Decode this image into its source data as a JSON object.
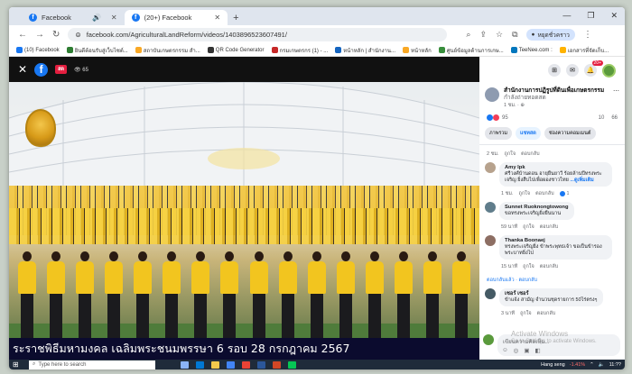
{
  "browser": {
    "tabs": [
      {
        "label": "Facebook",
        "active": false
      },
      {
        "label": "(20+) Facebook",
        "active": true
      }
    ],
    "new_tab": "+",
    "url": "facebook.com/AgriculturalLandReform/videos/1403896523607491/",
    "profile_label": "หยุดชั่วคราว",
    "bookmarks": [
      "(10) Facebook",
      "ยินดีต้อนรับสู่เว็บไซต์...",
      "สถาบันเกษตรกรรม สำ...",
      "QR Code Generator",
      "กรมเกษตรกร (1) - ...",
      "หน้าหลัก | สำนักงาน...",
      "หน้าหลัก",
      "ศูนย์ข้อมูลด้านการเกษ...",
      "TeeNee.com :",
      "เอกสารที่จัดเก็บ..."
    ]
  },
  "video": {
    "live_badge": "สด",
    "views": "65",
    "caption": "ระราชพิธีมหามงคล เฉลิมพระชนมพรรษา 6 รอบ 28 กรกฎาคม 2567",
    "people_count": 16
  },
  "panel": {
    "notif_count": "20+",
    "page_name": "สำนักงานการปฏิรูปที่ดินเพื่อเกษตรกรรม",
    "page_name_suffix": "กำลังถ่ายทอดสด",
    "page_meta": "1 ชม. · ⊕",
    "reaction_count": "95",
    "comment_count": "10",
    "share_count": "66",
    "tabs": [
      "ภาพรวม",
      "แชทสด",
      "ช่องความคอมเมนต์"
    ],
    "actions": {
      "time1": "2 ชม.",
      "like": "ถูกใจ",
      "reply": "ตอบกลับ"
    },
    "comments": [
      {
        "name": "Amy Ipk",
        "text": "ศรีวงศ์บ้านดอน อายุยืนยาวี ร้อยล้านปีทรงพระเจริญ ยิ่งสืบไปเพื่อผองชาวไทย",
        "tag": "...ดูเพิ่มเติม",
        "time": "1 ชม.",
        "likes": "1"
      },
      {
        "name": "Sunnet Ruoknongtowong",
        "text": "ขอทรงพระเจริญยิ่งยืนนาน",
        "tag": "",
        "time": "59 นาที",
        "likes": ""
      },
      {
        "name": "Thanka Boonaej",
        "text": "ทรงพระเจริญยิ่ง ข้าพระพุทธเจ้า ขอเป็นข้ารองพระบาทยิ่งไป",
        "tag": "",
        "time": "15 นาที",
        "likes": ""
      },
      {
        "name": "เซอร์ เซอร์",
        "text": "ข้าแจ้ง สามัญ จำนวนชุดรายการ 50ไร่ตรงๆ",
        "tag": "",
        "time": "3 นาที",
        "likes": ""
      }
    ],
    "reply_note": "ตอบกลับแล้ว · ตอบกลับ",
    "input_placeholder": "เขียนความคิดเห็น..."
  },
  "watermark": {
    "line1": "Activate Windows",
    "line2": "Go to Settings to activate Windows."
  },
  "taskbar": {
    "search_placeholder": "Type here to search",
    "stock_name": "Hang seng",
    "stock_change": "-1.41%",
    "time": "11:??"
  },
  "colors": {
    "brand": "#1877f2",
    "live": "#e41e3f",
    "shirt": "#f2c51f",
    "caption_bg": "#0b0b2e"
  }
}
